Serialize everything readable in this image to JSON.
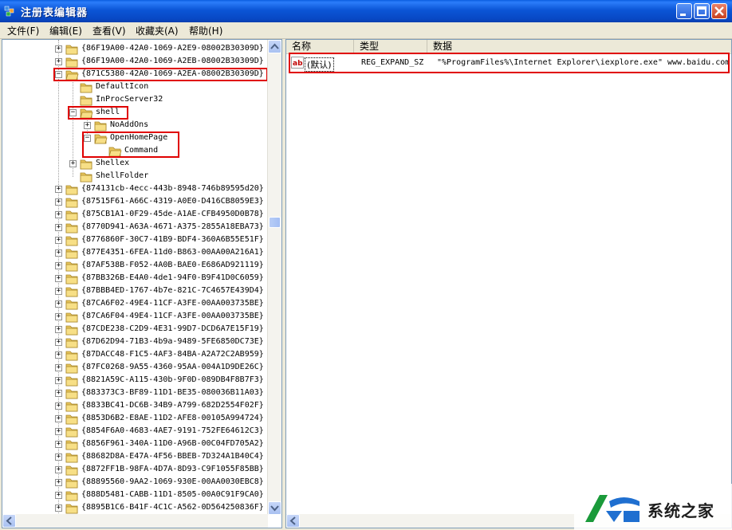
{
  "window": {
    "title": "注册表编辑器",
    "icon": "registry-editor-icon",
    "controls": [
      "minimize-icon",
      "maximize-icon",
      "close-icon"
    ]
  },
  "menu": [
    "文件(F)",
    "编辑(E)",
    "查看(V)",
    "收藏夹(A)",
    "帮助(H)"
  ],
  "tree": {
    "nodes": [
      {
        "label": "{86F19A00-42A0-1069-A2E9-08002B30309D}",
        "level": 0,
        "expander": "+",
        "highlight": false
      },
      {
        "label": "{86F19A00-42A0-1069-A2EB-08002B30309D}",
        "level": 0,
        "expander": "+",
        "highlight": false
      },
      {
        "label": "{871C5380-42A0-1069-A2EA-08002B30309D}",
        "level": 0,
        "expander": "-",
        "highlight": true,
        "open": true
      },
      {
        "label": "DefaultIcon",
        "level": 1,
        "expander": "",
        "highlight": false
      },
      {
        "label": "InProcServer32",
        "level": 1,
        "expander": "",
        "highlight": false
      },
      {
        "label": "shell",
        "level": 1,
        "expander": "-",
        "highlight": true,
        "open": true
      },
      {
        "label": "NoAddOns",
        "level": 2,
        "expander": "+",
        "highlight": false
      },
      {
        "label": "OpenHomePage",
        "level": 2,
        "expander": "-",
        "highlight": true,
        "open": true
      },
      {
        "label": "Command",
        "level": 3,
        "expander": "",
        "highlight": true,
        "open": true
      },
      {
        "label": "Shellex",
        "level": 1,
        "expander": "+",
        "highlight": false
      },
      {
        "label": "ShellFolder",
        "level": 1,
        "expander": "",
        "highlight": false
      },
      {
        "label": "{874131cb-4ecc-443b-8948-746b89595d20}",
        "level": 0,
        "expander": "+",
        "highlight": false
      },
      {
        "label": "{87515F61-A66C-4319-A0E0-D416CB8059E3}",
        "level": 0,
        "expander": "+",
        "highlight": false
      },
      {
        "label": "{875CB1A1-0F29-45de-A1AE-CFB4950D0B78}",
        "level": 0,
        "expander": "+",
        "highlight": false
      },
      {
        "label": "{8770D941-A63A-4671-A375-2855A18EBA73}",
        "level": 0,
        "expander": "+",
        "highlight": false
      },
      {
        "label": "{8776860F-30C7-41B9-BDF4-360A6B55E51F}",
        "level": 0,
        "expander": "+",
        "highlight": false
      },
      {
        "label": "{877E4351-6FEA-11d0-B863-00AA00A216A1}",
        "level": 0,
        "expander": "+",
        "highlight": false
      },
      {
        "label": "{87AF538B-F052-4A0B-BAE0-E686AD921119}",
        "level": 0,
        "expander": "+",
        "highlight": false
      },
      {
        "label": "{87BB326B-E4A0-4de1-94F0-B9F41D0C6059}",
        "level": 0,
        "expander": "+",
        "highlight": false
      },
      {
        "label": "{87BBB4ED-1767-4b7e-821C-7C4657E439D4}",
        "level": 0,
        "expander": "+",
        "highlight": false
      },
      {
        "label": "{87CA6F02-49E4-11CF-A3FE-00AA003735BE}",
        "level": 0,
        "expander": "+",
        "highlight": false
      },
      {
        "label": "{87CA6F04-49E4-11CF-A3FE-00AA003735BE}",
        "level": 0,
        "expander": "+",
        "highlight": false
      },
      {
        "label": "{87CDE238-C2D9-4E31-99D7-DCD6A7E15F19}",
        "level": 0,
        "expander": "+",
        "highlight": false
      },
      {
        "label": "{87D62D94-71B3-4b9a-9489-5FE6850DC73E}",
        "level": 0,
        "expander": "+",
        "highlight": false
      },
      {
        "label": "{87DACC48-F1C5-4AF3-84BA-A2A72C2AB959}",
        "level": 0,
        "expander": "+",
        "highlight": false
      },
      {
        "label": "{87FC0268-9A55-4360-95AA-004A1D9DE26C}",
        "level": 0,
        "expander": "+",
        "highlight": false
      },
      {
        "label": "{8821A59C-A115-430b-9F0D-089DB4F8B7F3}",
        "level": 0,
        "expander": "+",
        "highlight": false
      },
      {
        "label": "{883373C3-BF89-11D1-BE35-080036B11A03}",
        "level": 0,
        "expander": "+",
        "highlight": false
      },
      {
        "label": "{8833BC41-DC6B-34B9-A799-682D2554F02F}",
        "level": 0,
        "expander": "+",
        "highlight": false
      },
      {
        "label": "{8853D6B2-E8AE-11D2-AFE8-00105A994724}",
        "level": 0,
        "expander": "+",
        "highlight": false
      },
      {
        "label": "{8854F6A0-4683-4AE7-9191-752FE64612C3}",
        "level": 0,
        "expander": "+",
        "highlight": false
      },
      {
        "label": "{8856F961-340A-11D0-A96B-00C04FD705A2}",
        "level": 0,
        "expander": "+",
        "highlight": false
      },
      {
        "label": "{88682D8A-E47A-4F56-BBEB-7D324A1B40C4}",
        "level": 0,
        "expander": "+",
        "highlight": false
      },
      {
        "label": "{8872FF1B-98FA-4D7A-8D93-C9F1055F85BB}",
        "level": 0,
        "expander": "+",
        "highlight": false
      },
      {
        "label": "{88895560-9AA2-1069-930E-00AA0030EBC8}",
        "level": 0,
        "expander": "+",
        "highlight": false
      },
      {
        "label": "{888D5481-CABB-11D1-8505-00A0C91F9CA0}",
        "level": 0,
        "expander": "+",
        "highlight": false
      },
      {
        "label": "{8895B1C6-B41F-4C1C-A562-0D564250836F}",
        "level": 0,
        "expander": "+",
        "highlight": false
      }
    ]
  },
  "values": {
    "columns": [
      "名称",
      "类型",
      "数据"
    ],
    "rows": [
      {
        "icon": "string-value-icon",
        "name": "(默认)",
        "type": "REG_EXPAND_SZ",
        "data": "\"%ProgramFiles%\\Internet Explorer\\iexplore.exe\" www.baidu.com"
      }
    ]
  },
  "watermark": {
    "text": "系统之家"
  },
  "colors": {
    "highlight": "#e00000",
    "titlebar": "#0a55d6",
    "folder": "#f2d36a"
  }
}
